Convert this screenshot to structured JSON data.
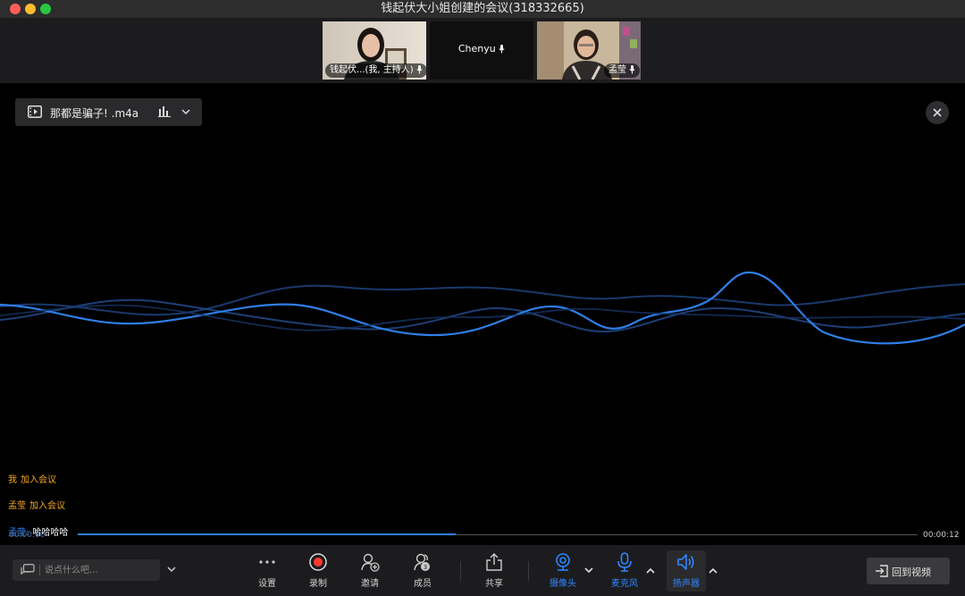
{
  "window": {
    "title": "钱起伏大小姐创建的会议(318332665)"
  },
  "participants": [
    {
      "name": "钱起伏...(我, 主持人)",
      "type": "video"
    },
    {
      "name": "Chenyu",
      "type": "audio-only"
    },
    {
      "name": "孟莹",
      "type": "video"
    }
  ],
  "media": {
    "file_name": "那都是骗子! .m4a",
    "elapsed": "00:00:00",
    "duration": "00:00:12",
    "progress": 0.45
  },
  "chat_messages": [
    {
      "sender": "我",
      "text": "加入会议"
    },
    {
      "sender": "孟莹",
      "text": "加入会议"
    },
    {
      "sender": "孟莹:",
      "text": "哈哈哈哈"
    }
  ],
  "chat_input": {
    "placeholder": "说点什么吧..."
  },
  "toolbar": {
    "settings": "设置",
    "record": "录制",
    "invite": "邀请",
    "members": "成员",
    "members_count": "3",
    "share": "共享",
    "camera": "摄像头",
    "microphone": "麦克风",
    "speaker": "扬声器",
    "back_to_video": "回到视频"
  },
  "colors": {
    "accent": "#2f86ff",
    "record": "#ff3b30",
    "system_message": "#f5a623"
  }
}
